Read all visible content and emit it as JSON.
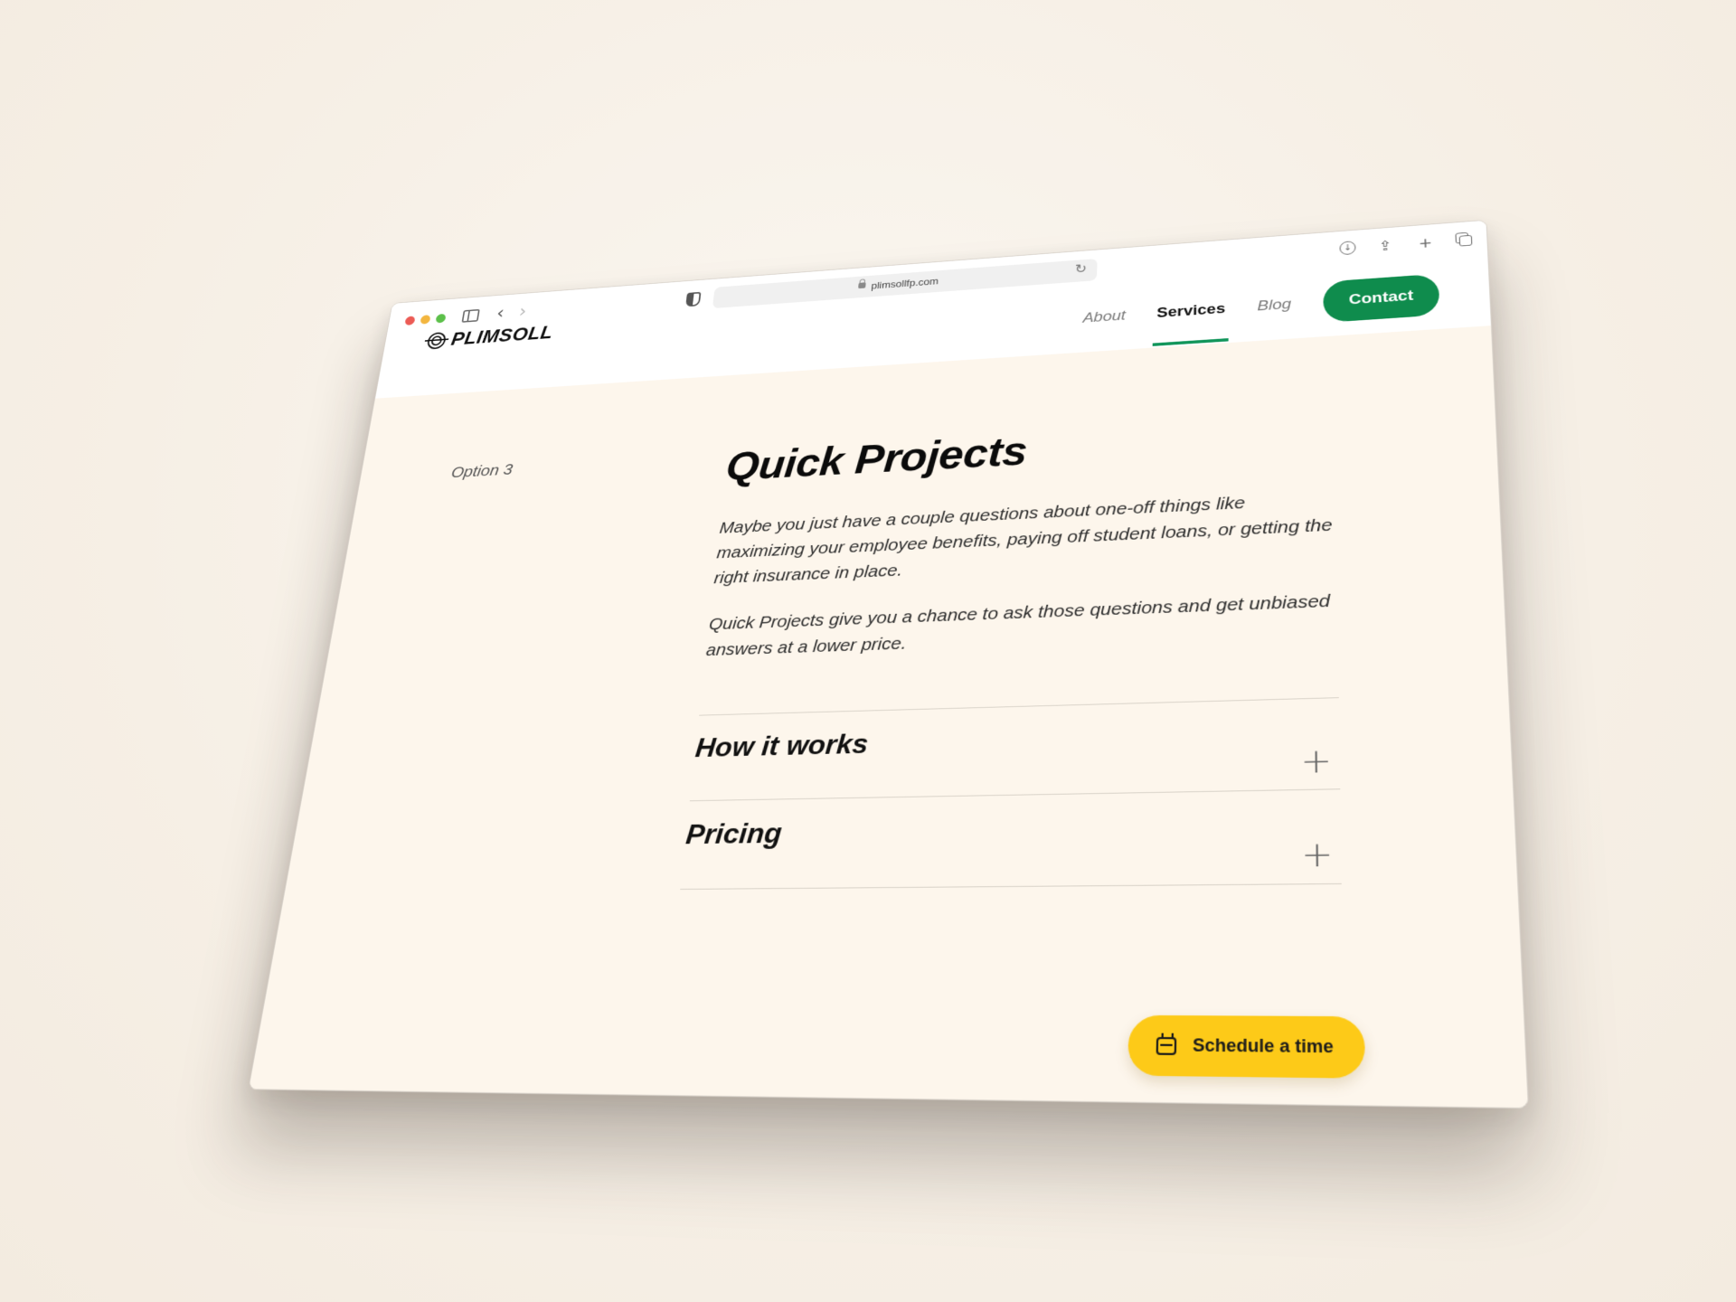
{
  "browser": {
    "url": "plimsollfp.com",
    "controls": {
      "back_icon": "‹",
      "forward_icon": "›",
      "reload_icon": "↻"
    },
    "actions": {
      "download_icon": "↓",
      "share_icon": "⇪",
      "new_tab_icon": "+"
    }
  },
  "site": {
    "logo_text": "PLIMSOLL",
    "nav": {
      "items": [
        {
          "label": "About",
          "active": false
        },
        {
          "label": "Services",
          "active": true
        },
        {
          "label": "Blog",
          "active": false
        }
      ],
      "contact_label": "Contact"
    },
    "colors": {
      "brand_green": "#0f8c4d",
      "active_underline": "#10955a",
      "cta_yellow": "#fdca18",
      "page_bg": "#fdf6ec"
    }
  },
  "content": {
    "option_label": "Option 3",
    "title": "Quick Projects",
    "paragraphs": [
      "Maybe you just have a couple questions about one-off things like maximizing your employee benefits, paying off student loans, or getting the right insurance in place.",
      "Quick Projects give you a chance to ask those questions and get unbiased answers at a lower price."
    ],
    "accordion": [
      {
        "title": "How it works",
        "icon": "+"
      },
      {
        "title": "Pricing",
        "icon": "+"
      }
    ],
    "schedule_label": "Schedule a time"
  }
}
